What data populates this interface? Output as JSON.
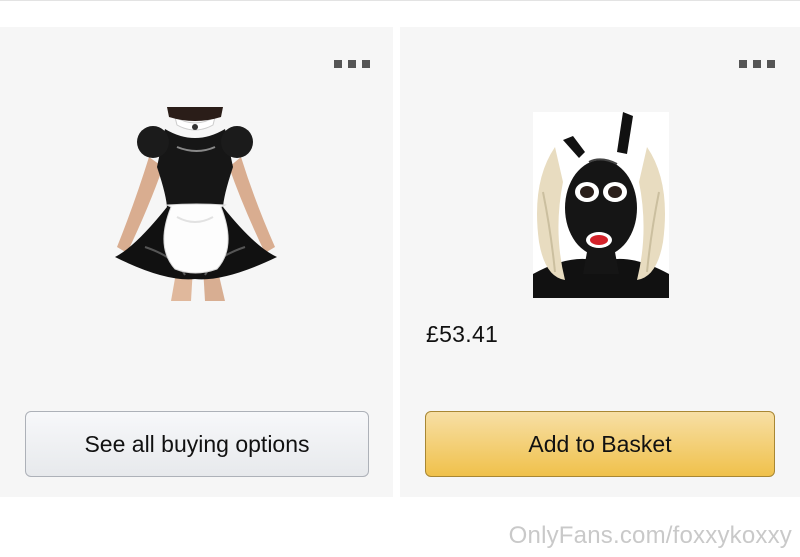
{
  "products": [
    {
      "image_icon": "maid-dress-product-image",
      "more_icon": "more-options-icon",
      "price": "",
      "button_label": "See all buying options"
    },
    {
      "image_icon": "latex-hood-product-image",
      "more_icon": "more-options-icon",
      "price": "£53.41",
      "button_label": "Add to Basket"
    }
  ],
  "colors": {
    "card_bg": "#f6f6f6",
    "secondary_button": "#e7e9ec",
    "primary_button": "#f0c14b",
    "watermark": "#c9c9c9"
  },
  "watermark": "OnlyFans.com/foxxykoxxy"
}
